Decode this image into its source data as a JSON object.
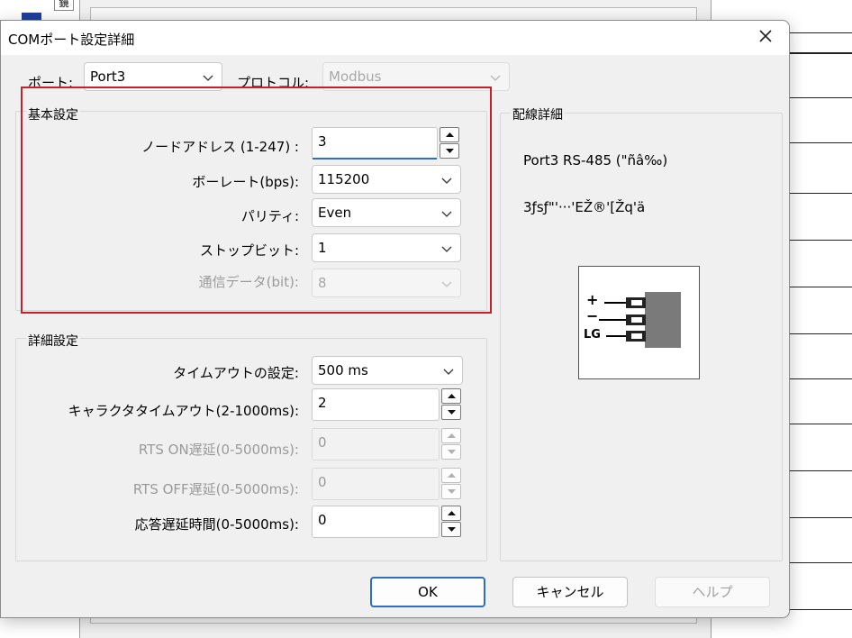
{
  "background": {
    "tree_node_glyph": "鏡"
  },
  "dialog": {
    "title": "COMポート設定詳細",
    "port_label": "ポート:",
    "port_value": "Port3",
    "protocol_label": "プロトコル:",
    "protocol_value": "Modbus",
    "basic": {
      "group_label": "基本設定",
      "node_address_label": "ノードアドレス (1-247) :",
      "node_address_value": "3",
      "baud_label": "ボーレート(bps):",
      "baud_value": "115200",
      "parity_label": "パリティ:",
      "parity_value": "Even",
      "stopbit_label": "ストップビット:",
      "stopbit_value": "1",
      "databits_label": "通信データ(bit):",
      "databits_value": "8"
    },
    "advanced": {
      "group_label": "詳細設定",
      "timeout_label": "タイムアウトの設定:",
      "timeout_value": "500 ms",
      "char_timeout_label": "キャラクタタイムアウト(2-1000ms):",
      "char_timeout_value": "2",
      "rts_on_label": "RTS ON遅延(0-5000ms):",
      "rts_on_value": "0",
      "rts_off_label": "RTS OFF遅延(0-5000ms):",
      "rts_off_value": "0",
      "response_delay_label": "応答遅延時間(0-5000ms):",
      "response_delay_value": "0"
    },
    "wiring": {
      "group_label": "配線詳細",
      "line1": "Port3 RS-485 (\"ñâ‰)",
      "line2": "3ƒsƒ\"'···'EŽ®'[Žq'ä",
      "pin_plus": "+",
      "pin_minus": "−",
      "pin_lg": "LG"
    },
    "buttons": {
      "ok": "OK",
      "cancel": "キャンセル",
      "help": "ヘルプ"
    }
  },
  "colors": {
    "highlight_border": "#c8202a",
    "focus_underline": "#2f6cc6",
    "primary_border": "#2d6fbd"
  }
}
